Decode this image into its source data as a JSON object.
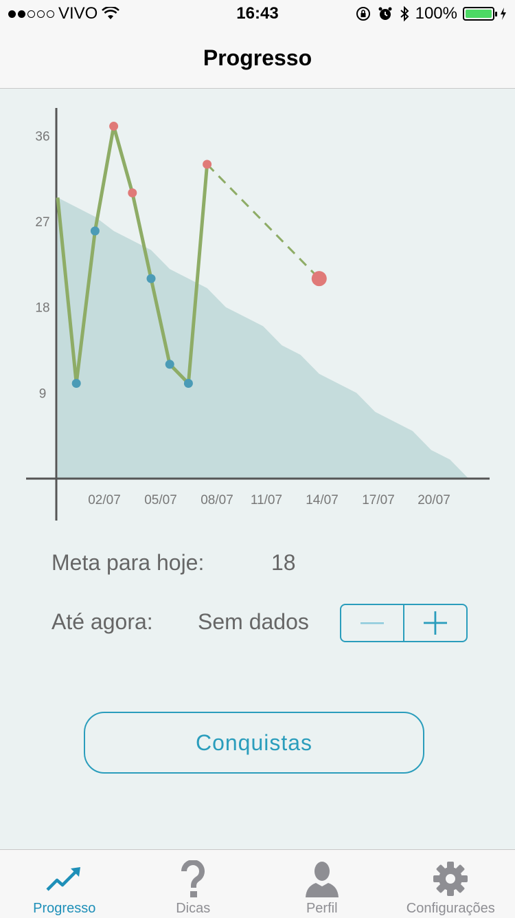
{
  "status_bar": {
    "carrier": "VIVO",
    "time": "16:43",
    "battery": "100%"
  },
  "nav": {
    "title": "Progresso"
  },
  "chart_data": {
    "type": "line",
    "y_ticks": [
      "36",
      "27",
      "18",
      "9"
    ],
    "x_ticks": [
      "02/07",
      "05/07",
      "08/07",
      "11/07",
      "14/07",
      "17/07",
      "20/07"
    ],
    "ylim": [
      0,
      39
    ],
    "series": [
      {
        "style": "line-with-points",
        "color": "#8eac66",
        "points": [
          {
            "x": 0.0,
            "y": 29.5,
            "color": null
          },
          {
            "x": 1.0,
            "y": 10,
            "color": "#4b9bb6"
          },
          {
            "x": 2.0,
            "y": 26,
            "color": "#4b9bb6"
          },
          {
            "x": 3.0,
            "y": 37,
            "color": "#e07a78"
          },
          {
            "x": 4.0,
            "y": 30,
            "color": "#e07a78"
          },
          {
            "x": 5.0,
            "y": 21,
            "color": "#4b9bb6"
          },
          {
            "x": 6.0,
            "y": 12,
            "color": "#4b9bb6"
          },
          {
            "x": 7.0,
            "y": 10,
            "color": "#4b9bb6"
          },
          {
            "x": 8.0,
            "y": 33,
            "color": "#e07a78"
          }
        ]
      },
      {
        "style": "dashed-projection",
        "color": "#8eac66",
        "points": [
          {
            "x": 8.0,
            "y": 33,
            "color": "#e07a78"
          },
          {
            "x": 14.0,
            "y": 21,
            "color": "#e07a78"
          }
        ]
      },
      {
        "style": "area",
        "color": "#c5dcdc",
        "points": [
          {
            "x": 0.0,
            "y": 29.5
          },
          {
            "x": 1.0,
            "y": 28.5
          },
          {
            "x": 2.0,
            "y": 27.5
          },
          {
            "x": 3.0,
            "y": 26
          },
          {
            "x": 4.0,
            "y": 25
          },
          {
            "x": 5.0,
            "y": 24
          },
          {
            "x": 6.0,
            "y": 22
          },
          {
            "x": 7.0,
            "y": 21
          },
          {
            "x": 8.0,
            "y": 20
          },
          {
            "x": 9.0,
            "y": 18
          },
          {
            "x": 10.0,
            "y": 17
          },
          {
            "x": 11.0,
            "y": 16
          },
          {
            "x": 12.0,
            "y": 14
          },
          {
            "x": 13.0,
            "y": 13
          },
          {
            "x": 14.0,
            "y": 11
          },
          {
            "x": 15.0,
            "y": 10
          },
          {
            "x": 16.0,
            "y": 9
          },
          {
            "x": 17.0,
            "y": 7
          },
          {
            "x": 18.0,
            "y": 6
          },
          {
            "x": 19.0,
            "y": 5
          },
          {
            "x": 20.0,
            "y": 3
          },
          {
            "x": 21.0,
            "y": 2
          },
          {
            "x": 22.0,
            "y": 0
          }
        ]
      }
    ],
    "grid": false
  },
  "goal": {
    "label": "Meta para hoje:",
    "value": "18"
  },
  "progress": {
    "label": "Até agora:",
    "value": "Sem dados"
  },
  "achievements_button": "Conquistas",
  "tabs": [
    {
      "label": "Progresso",
      "icon": "trending-up-icon",
      "active": true
    },
    {
      "label": "Dicas",
      "icon": "question-icon",
      "active": false
    },
    {
      "label": "Perfil",
      "icon": "person-icon",
      "active": false
    },
    {
      "label": "Configurações",
      "icon": "gear-icon",
      "active": false
    }
  ],
  "colors": {
    "accent": "#2a9dbc",
    "line": "#8eac66",
    "area": "#c5dcdc",
    "point_blue": "#4b9bb6",
    "point_red": "#e07a78"
  }
}
